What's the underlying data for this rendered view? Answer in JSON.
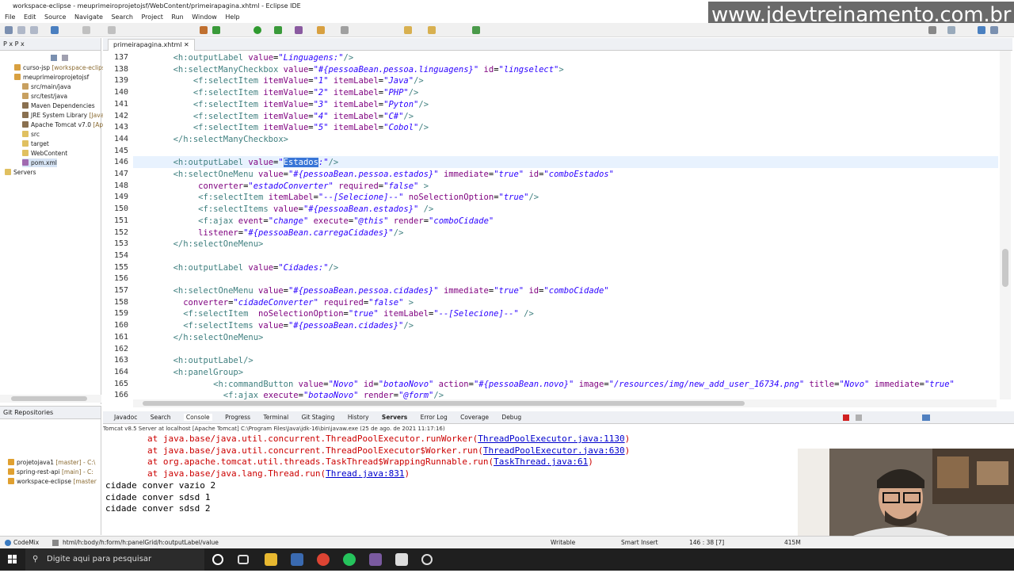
{
  "window": {
    "title": "workspace-eclipse - meuprimeiroprojetojsf/WebContent/primeirapagina.xhtml - Eclipse IDE"
  },
  "watermark": "www.jdevtreinamento.com.br",
  "menu": [
    "File",
    "Edit",
    "Source",
    "Navigate",
    "Search",
    "Project",
    "Run",
    "Window",
    "Help"
  ],
  "explorer": {
    "tabs": "P  x  P  x",
    "items": [
      {
        "label": "curso-jsp",
        "dec": "[workspace-eclipse"
      },
      {
        "label": "meuprimeiroprojetojsf",
        "dec": ""
      },
      {
        "label": "src/main/java",
        "dec": ""
      },
      {
        "label": "src/test/java",
        "dec": ""
      },
      {
        "label": "Maven Dependencies",
        "dec": ""
      },
      {
        "label": "JRE System Library",
        "dec": "[JavaSE"
      },
      {
        "label": "Apache Tomcat v7.0",
        "dec": "[Apa"
      },
      {
        "label": "src",
        "dec": ""
      },
      {
        "label": "target",
        "dec": ""
      },
      {
        "label": "WebContent",
        "dec": ""
      },
      {
        "label": "pom.xml",
        "dec": ""
      },
      {
        "label": "Servers",
        "dec": ""
      }
    ]
  },
  "git": {
    "title": "Git Repositories",
    "items": [
      {
        "label": "projetojava1",
        "dec": "[master] - C:\\"
      },
      {
        "label": "spring-rest-api",
        "dec": "[main] - C:"
      },
      {
        "label": "workspace-eclipse",
        "dec": "[master"
      }
    ]
  },
  "editor": {
    "tab": "primeirapagina.xhtml",
    "lines": [
      {
        "n": "137",
        "s": [
          [
            "t",
            "        <h:outputLabel "
          ],
          [
            "a",
            "value"
          ],
          [
            "p",
            "="
          ],
          [
            "v",
            "\"Linguagens:\""
          ],
          [
            "t",
            "/>"
          ]
        ]
      },
      {
        "n": "138",
        "s": [
          [
            "t",
            "        <h:selectManyCheckbox "
          ],
          [
            "a",
            "value"
          ],
          [
            "p",
            "="
          ],
          [
            "v",
            "\"#{pessoaBean.pessoa.linguagens}\""
          ],
          [
            "a",
            " id"
          ],
          [
            "p",
            "="
          ],
          [
            "v",
            "\"lingselect\""
          ],
          [
            "t",
            ">"
          ]
        ]
      },
      {
        "n": "139",
        "s": [
          [
            "t",
            "            <f:selectItem "
          ],
          [
            "a",
            "itemValue"
          ],
          [
            "p",
            "="
          ],
          [
            "v",
            "\"1\""
          ],
          [
            "a",
            " itemLabel"
          ],
          [
            "p",
            "="
          ],
          [
            "v",
            "\"Java\""
          ],
          [
            "t",
            "/>"
          ]
        ]
      },
      {
        "n": "140",
        "s": [
          [
            "t",
            "            <f:selectItem "
          ],
          [
            "a",
            "itemValue"
          ],
          [
            "p",
            "="
          ],
          [
            "v",
            "\"2\""
          ],
          [
            "a",
            " itemLabel"
          ],
          [
            "p",
            "="
          ],
          [
            "v",
            "\"PHP\""
          ],
          [
            "t",
            "/>"
          ]
        ]
      },
      {
        "n": "141",
        "s": [
          [
            "t",
            "            <f:selectItem "
          ],
          [
            "a",
            "itemValue"
          ],
          [
            "p",
            "="
          ],
          [
            "v",
            "\"3\""
          ],
          [
            "a",
            " itemLabel"
          ],
          [
            "p",
            "="
          ],
          [
            "v",
            "\"Pyton\""
          ],
          [
            "t",
            "/>"
          ]
        ]
      },
      {
        "n": "142",
        "s": [
          [
            "t",
            "            <f:selectItem "
          ],
          [
            "a",
            "itemValue"
          ],
          [
            "p",
            "="
          ],
          [
            "v",
            "\"4\""
          ],
          [
            "a",
            " itemLabel"
          ],
          [
            "p",
            "="
          ],
          [
            "v",
            "\"C#\""
          ],
          [
            "t",
            "/>"
          ]
        ]
      },
      {
        "n": "143",
        "s": [
          [
            "t",
            "            <f:selectItem "
          ],
          [
            "a",
            "itemValue"
          ],
          [
            "p",
            "="
          ],
          [
            "v",
            "\"5\""
          ],
          [
            "a",
            " itemLabel"
          ],
          [
            "p",
            "="
          ],
          [
            "v",
            "\"Cobol\""
          ],
          [
            "t",
            "/>"
          ]
        ]
      },
      {
        "n": "144",
        "s": [
          [
            "t",
            "        </h:selectManyCheckbox>"
          ]
        ]
      },
      {
        "n": "145",
        "s": []
      },
      {
        "n": "146",
        "s": [
          [
            "t",
            "        <h:outputLabel "
          ],
          [
            "a",
            "value"
          ],
          [
            "p",
            "="
          ],
          [
            "v",
            "\""
          ],
          [
            "hl",
            "Estados"
          ],
          [
            "v",
            ":\""
          ],
          [
            "t",
            "/>"
          ]
        ]
      },
      {
        "n": "147",
        "s": [
          [
            "t",
            "        <h:selectOneMenu "
          ],
          [
            "a",
            "value"
          ],
          [
            "p",
            "="
          ],
          [
            "v",
            "\"#{pessoaBean.pessoa.estados}\""
          ],
          [
            "a",
            " immediate"
          ],
          [
            "p",
            "="
          ],
          [
            "v",
            "\"true\""
          ],
          [
            "a",
            " id"
          ],
          [
            "p",
            "="
          ],
          [
            "v",
            "\"comboEstados\""
          ]
        ]
      },
      {
        "n": "148",
        "s": [
          [
            "a",
            "             converter"
          ],
          [
            "p",
            "="
          ],
          [
            "v",
            "\"estadoConverter\""
          ],
          [
            "a",
            " required"
          ],
          [
            "p",
            "="
          ],
          [
            "v",
            "\"false\""
          ],
          [
            "t",
            " >"
          ]
        ]
      },
      {
        "n": "149",
        "s": [
          [
            "t",
            "             <f:selectItem "
          ],
          [
            "a",
            "itemLabel"
          ],
          [
            "p",
            "="
          ],
          [
            "v",
            "\"--[Selecione]--\""
          ],
          [
            "a",
            " noSelectionOption"
          ],
          [
            "p",
            "="
          ],
          [
            "v",
            "\"true\""
          ],
          [
            "t",
            "/>"
          ]
        ]
      },
      {
        "n": "150",
        "s": [
          [
            "t",
            "             <f:selectItems "
          ],
          [
            "a",
            "value"
          ],
          [
            "p",
            "="
          ],
          [
            "v",
            "\"#{pessoaBean.estados}\""
          ],
          [
            "t",
            " />"
          ]
        ]
      },
      {
        "n": "151",
        "s": [
          [
            "t",
            "             <f:ajax "
          ],
          [
            "a",
            "event"
          ],
          [
            "p",
            "="
          ],
          [
            "v",
            "\"change\""
          ],
          [
            "a",
            " execute"
          ],
          [
            "p",
            "="
          ],
          [
            "v",
            "\"@this\""
          ],
          [
            "a",
            " render"
          ],
          [
            "p",
            "="
          ],
          [
            "v",
            "\"comboCidade\""
          ]
        ]
      },
      {
        "n": "152",
        "s": [
          [
            "a",
            "             listener"
          ],
          [
            "p",
            "="
          ],
          [
            "v",
            "\"#{pessoaBean.carregaCidades}\""
          ],
          [
            "t",
            "/>"
          ]
        ]
      },
      {
        "n": "153",
        "s": [
          [
            "t",
            "        </h:selectOneMenu>"
          ]
        ]
      },
      {
        "n": "154",
        "s": []
      },
      {
        "n": "155",
        "s": [
          [
            "t",
            "        <h:outputLabel "
          ],
          [
            "a",
            "value"
          ],
          [
            "p",
            "="
          ],
          [
            "v",
            "\"Cidades:\""
          ],
          [
            "t",
            "/>"
          ]
        ]
      },
      {
        "n": "156",
        "s": []
      },
      {
        "n": "157",
        "s": [
          [
            "t",
            "        <h:selectOneMenu "
          ],
          [
            "a",
            "value"
          ],
          [
            "p",
            "="
          ],
          [
            "v",
            "\"#{pessoaBean.pessoa.cidades}\""
          ],
          [
            "a",
            " immediate"
          ],
          [
            "p",
            "="
          ],
          [
            "v",
            "\"true\""
          ],
          [
            "a",
            " id"
          ],
          [
            "p",
            "="
          ],
          [
            "v",
            "\"comboCidade\""
          ]
        ]
      },
      {
        "n": "158",
        "s": [
          [
            "a",
            "          converter"
          ],
          [
            "p",
            "="
          ],
          [
            "v",
            "\"cidadeConverter\""
          ],
          [
            "a",
            " required"
          ],
          [
            "p",
            "="
          ],
          [
            "v",
            "\"false\""
          ],
          [
            "t",
            " >"
          ]
        ]
      },
      {
        "n": "159",
        "s": [
          [
            "t",
            "          <f:selectItem  "
          ],
          [
            "a",
            "noSelectionOption"
          ],
          [
            "p",
            "="
          ],
          [
            "v",
            "\"true\""
          ],
          [
            "a",
            " itemLabel"
          ],
          [
            "p",
            "="
          ],
          [
            "v",
            "\"--[Selecione]--\""
          ],
          [
            "t",
            " />"
          ]
        ]
      },
      {
        "n": "160",
        "s": [
          [
            "t",
            "          <f:selectItems "
          ],
          [
            "a",
            "value"
          ],
          [
            "p",
            "="
          ],
          [
            "v",
            "\"#{pessoaBean.cidades}\""
          ],
          [
            "t",
            "/>"
          ]
        ]
      },
      {
        "n": "161",
        "s": [
          [
            "t",
            "        </h:selectOneMenu>"
          ]
        ]
      },
      {
        "n": "162",
        "s": []
      },
      {
        "n": "163",
        "s": [
          [
            "t",
            "        <h:outputLabel/>"
          ]
        ]
      },
      {
        "n": "164",
        "s": [
          [
            "t",
            "        <h:panelGroup>"
          ]
        ]
      },
      {
        "n": "165",
        "s": [
          [
            "t",
            "                <h:commandButton "
          ],
          [
            "a",
            "value"
          ],
          [
            "p",
            "="
          ],
          [
            "v",
            "\"Novo\""
          ],
          [
            "a",
            " id"
          ],
          [
            "p",
            "="
          ],
          [
            "v",
            "\"botaoNovo\""
          ],
          [
            "a",
            " action"
          ],
          [
            "p",
            "="
          ],
          [
            "v",
            "\"#{pessoaBean.novo}\""
          ],
          [
            "a",
            " image"
          ],
          [
            "p",
            "="
          ],
          [
            "v",
            "\"/resources/img/new_add_user_16734.png\""
          ],
          [
            "a",
            " title"
          ],
          [
            "p",
            "="
          ],
          [
            "v",
            "\"Novo\""
          ],
          [
            "a",
            " immediate"
          ],
          [
            "p",
            "="
          ],
          [
            "v",
            "\"true\""
          ]
        ]
      },
      {
        "n": "166",
        "s": [
          [
            "t",
            "                  <f:ajax "
          ],
          [
            "a",
            "execute"
          ],
          [
            "p",
            "="
          ],
          [
            "v",
            "\"botaoNovo\""
          ],
          [
            "a",
            " render"
          ],
          [
            "p",
            "="
          ],
          [
            "v",
            "\"@form\""
          ],
          [
            "t",
            "/>"
          ]
        ]
      }
    ]
  },
  "console": {
    "tabs": [
      "Javadoc",
      "Search",
      "Console",
      "Progress",
      "Terminal",
      "Git Staging",
      "History",
      "Servers",
      "Error Log",
      "Coverage",
      "Debug"
    ],
    "title": "Tomcat v8.5 Server at localhost [Apache Tomcat] C:\\Program Files\\Java\\jdk-16\\bin\\javaw.exe  (25 de ago. de 2021 11:17:16)",
    "lines": [
      {
        "s": [
          [
            "err",
            "        at java.base/java.util.concurrent.ThreadPoolExecutor.runWorker("
          ],
          [
            "lk",
            "ThreadPoolExecutor.java:1130"
          ],
          [
            "err",
            ")"
          ]
        ]
      },
      {
        "s": [
          [
            "err",
            "        at java.base/java.util.concurrent.ThreadPoolExecutor$Worker.run("
          ],
          [
            "lk",
            "ThreadPoolExecutor.java:630"
          ],
          [
            "err",
            ")"
          ]
        ]
      },
      {
        "s": [
          [
            "err",
            "        at org.apache.tomcat.util.threads.TaskThread$WrappingRunnable.run("
          ],
          [
            "lk",
            "TaskThread.java:61"
          ],
          [
            "err",
            ")"
          ]
        ]
      },
      {
        "s": [
          [
            "err",
            "        at java.base/java.lang.Thread.run("
          ],
          [
            "lk",
            "Thread.java:831"
          ],
          [
            "err",
            ")"
          ]
        ]
      },
      {
        "s": [
          [
            "p",
            "cidade conver vazio 2"
          ]
        ]
      },
      {
        "s": [
          [
            "p",
            "cidade conver sdsd 1"
          ]
        ]
      },
      {
        "s": [
          [
            "p",
            "cidade conver sdsd 2"
          ]
        ]
      }
    ]
  },
  "status": {
    "codemix": "CodeMix",
    "path": "html/h:body/h:form/h:panelGrid/h:outputLabel/value",
    "writable": "Writable",
    "insert": "Smart Insert",
    "position": "146 : 38 [7]",
    "mem": "415M"
  },
  "taskbar": {
    "search_placeholder": "Digite aqui para pesquisar"
  },
  "colors": {
    "tag": "#3f7f7f",
    "attr": "#7f007f",
    "value": "#2a00ff",
    "error": "#cc0000",
    "link": "#0000cc",
    "selection": "#3875d7"
  }
}
